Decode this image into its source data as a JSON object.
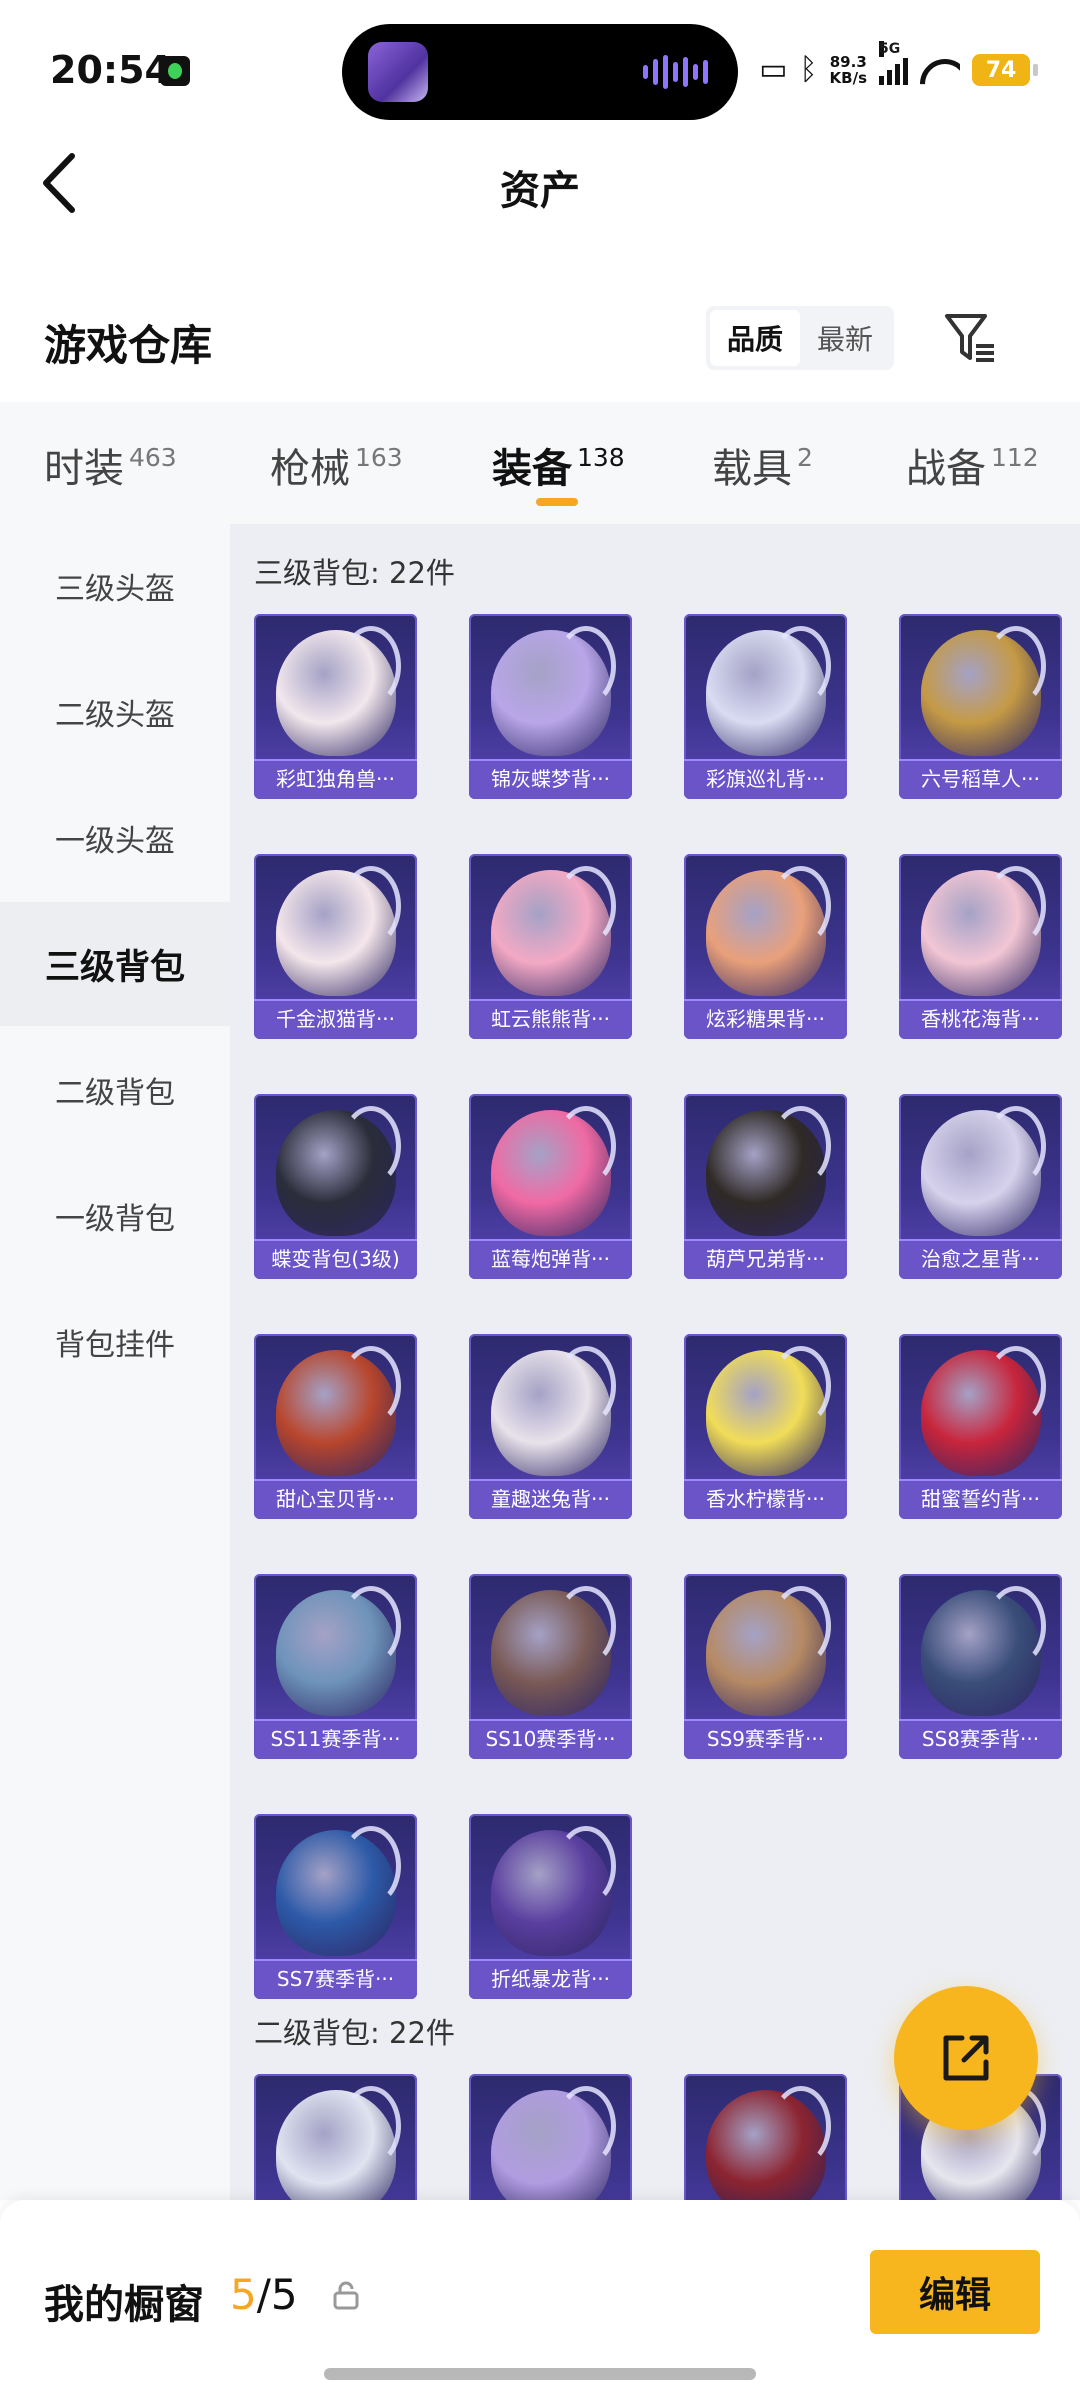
{
  "status_bar": {
    "time": "20:54",
    "net_speed_value": "89.3",
    "net_speed_unit": "KB/s",
    "signal_label": "5G",
    "battery": "74"
  },
  "header": {
    "title": "资产"
  },
  "section": {
    "title": "游戏仓库",
    "sort_options": [
      "品质",
      "最新"
    ],
    "active_sort": "品质"
  },
  "tabs": [
    {
      "label": "时装",
      "count": "463"
    },
    {
      "label": "枪械",
      "count": "163"
    },
    {
      "label": "装备",
      "count": "138",
      "active": true
    },
    {
      "label": "载具",
      "count": "2"
    },
    {
      "label": "战备",
      "count": "112"
    }
  ],
  "sidebar": {
    "items": [
      "三级头盔",
      "二级头盔",
      "一级头盔",
      "三级背包",
      "二级背包",
      "一级背包",
      "背包挂件"
    ],
    "active": "三级背包"
  },
  "groups": [
    {
      "title": "三级背包: 22件",
      "items": [
        {
          "name": "彩虹独角兽···",
          "color": "#f1e7ec"
        },
        {
          "name": "锦灰蝶梦背···",
          "color": "#b8a6e8"
        },
        {
          "name": "彩旗巡礼背···",
          "color": "#d9dcf2"
        },
        {
          "name": "六号稻草人···",
          "color": "#c59a45"
        },
        {
          "name": "千金淑猫背···",
          "color": "#f4e6ea"
        },
        {
          "name": "虹云熊熊背···",
          "color": "#f3a9c4"
        },
        {
          "name": "炫彩糖果背···",
          "color": "#e9a07a"
        },
        {
          "name": "香桃花海背···",
          "color": "#f2c6d4"
        },
        {
          "name": "蝶变背包(3级)",
          "color": "#2b2d3a"
        },
        {
          "name": "蓝莓炮弹背···",
          "color": "#f06aa4"
        },
        {
          "name": "葫芦兄弟背···",
          "color": "#2f2a26"
        },
        {
          "name": "治愈之星背···",
          "color": "#d6d2ec"
        },
        {
          "name": "甜心宝贝背···",
          "color": "#b8462d"
        },
        {
          "name": "童趣迷兔背···",
          "color": "#e8e2ea"
        },
        {
          "name": "香水柠檬背···",
          "color": "#f1dd58"
        },
        {
          "name": "甜蜜誓约背···",
          "color": "#c8253c"
        },
        {
          "name": "SS11赛季背···",
          "color": "#6e93ba"
        },
        {
          "name": "SS10赛季背···",
          "color": "#7a5a56"
        },
        {
          "name": "SS9赛季背···",
          "color": "#b68a64"
        },
        {
          "name": "SS8赛季背···",
          "color": "#3a4e7a"
        },
        {
          "name": "SS7赛季背···",
          "color": "#2d5aa8"
        },
        {
          "name": "折纸暴龙背···",
          "color": "#5b3fa0"
        }
      ]
    },
    {
      "title": "二级背包: 22件",
      "items": [
        {
          "name": "",
          "color": "#dfe4f0"
        },
        {
          "name": "",
          "color": "#b09ce0"
        },
        {
          "name": "",
          "color": "#8c2430"
        },
        {
          "name": "",
          "color": "#e6e6ee"
        }
      ]
    }
  ],
  "showcase": {
    "label": "我的橱窗",
    "used": "5",
    "separator": "/",
    "total": "5",
    "edit_label": "编辑"
  },
  "colors": {
    "accent": "#f7b51e",
    "card_bg": "#3d348e",
    "card_label_bg": "#6a54c8"
  },
  "icons": {
    "back": "chevron-left-icon",
    "filter": "filter-icon",
    "share": "share-external-icon",
    "lock": "lock-icon"
  }
}
